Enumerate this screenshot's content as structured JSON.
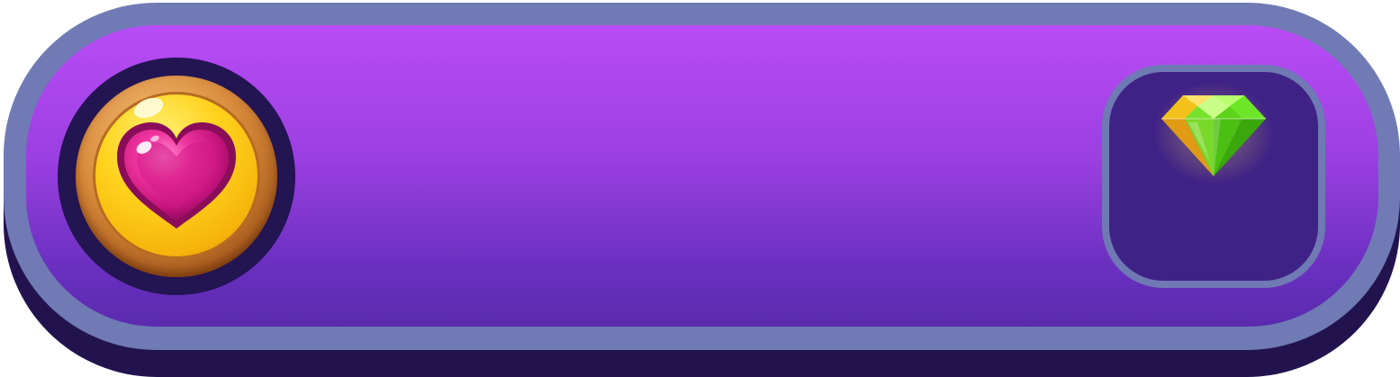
{
  "hud": {
    "lives_icon": "heart-icon",
    "gem_icon": "green-gem-icon"
  },
  "colors": {
    "frame": "#707ab4",
    "shadow": "#22134f",
    "fill_top": "#b94cf6",
    "fill_bottom": "#5a2aae",
    "gem_button_bg": "#3f2286",
    "heart": "#e01c8c",
    "coin": "#ffd21c",
    "gem": "#5fdc12"
  }
}
